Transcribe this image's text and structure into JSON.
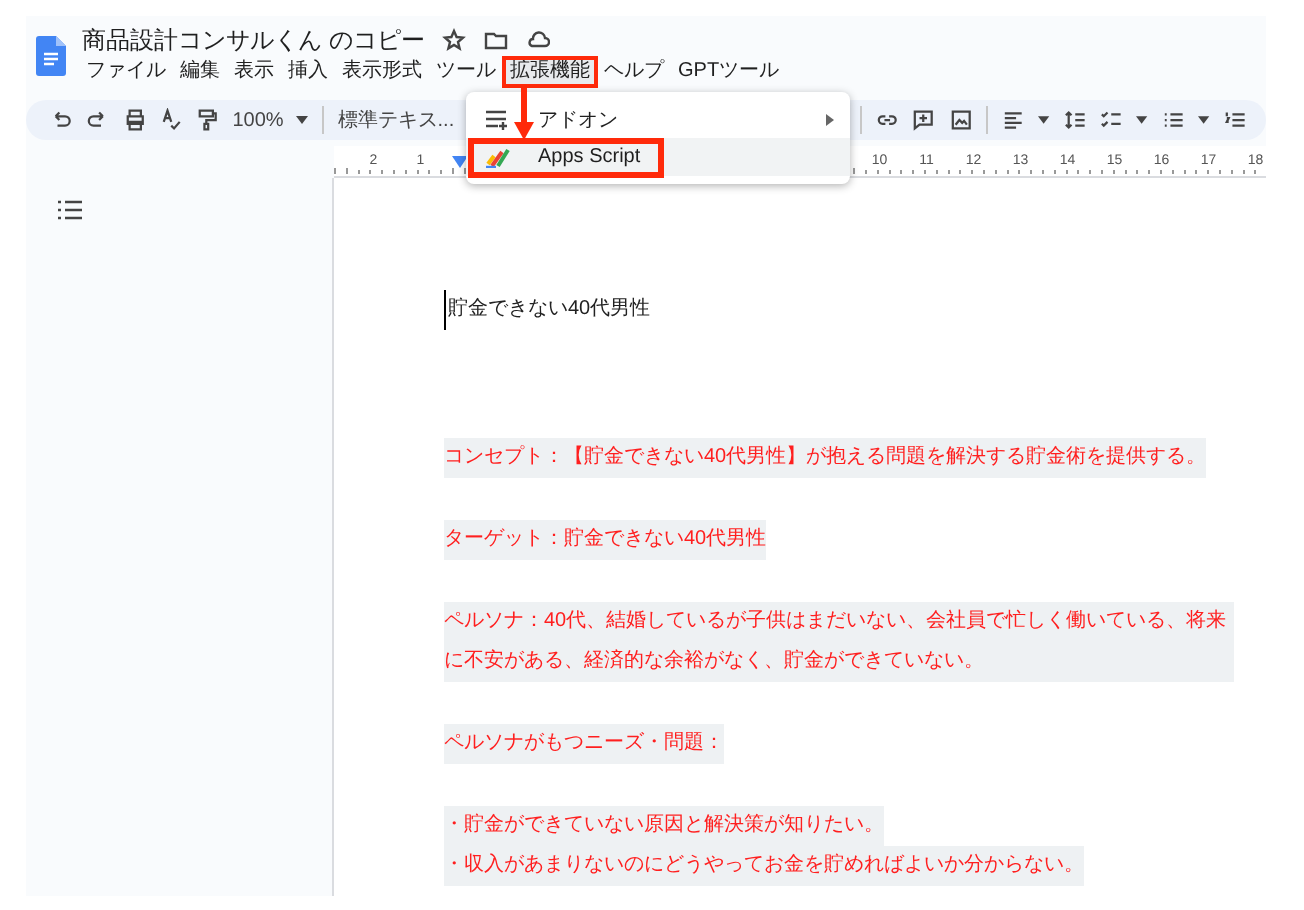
{
  "document": {
    "title": "商品設計コンサルくん のコピー"
  },
  "menubar": [
    {
      "label": "ファイル",
      "annotated": false
    },
    {
      "label": "編集",
      "annotated": false
    },
    {
      "label": "表示",
      "annotated": false
    },
    {
      "label": "挿入",
      "annotated": false
    },
    {
      "label": "表示形式",
      "annotated": false
    },
    {
      "label": "ツール",
      "annotated": false
    },
    {
      "label": "拡張機能",
      "annotated": true
    },
    {
      "label": "ヘルプ",
      "annotated": false
    },
    {
      "label": "GPTツール",
      "annotated": false
    }
  ],
  "toolbar": {
    "zoom": "100%",
    "style": "標準テキス..."
  },
  "ruler": {
    "left_labels": [
      "2",
      "1"
    ],
    "right_labels": [
      "10",
      "11",
      "12",
      "13",
      "14",
      "15",
      "16",
      "17",
      "18"
    ]
  },
  "dropdown": [
    {
      "label": "アドオン",
      "submenu": true,
      "selected": false,
      "annotated": false
    },
    {
      "label": "Apps Script",
      "submenu": false,
      "selected": true,
      "annotated": true
    }
  ],
  "paragraphs": [
    {
      "kind": "plain",
      "text": "貯金できない40代男性"
    },
    {
      "kind": "highlighted",
      "text": "コンセプト：【貯金できない40代男性】が抱える問題を解決する貯金術を提供する。"
    },
    {
      "kind": "highlighted",
      "text": "ターゲット：貯金できない40代男性"
    },
    {
      "kind": "highlighted",
      "text": "ペルソナ：40代、結婚しているが子供はまだいない、会社員で忙しく働いている、将来に不安がある、経済的な余裕がなく、貯金ができていない。"
    },
    {
      "kind": "highlighted",
      "text": "ペルソナがもつニーズ・問題："
    },
    {
      "kind": "bullet",
      "text": "・貯金ができていない原因と解決策が知りたい。"
    },
    {
      "kind": "bullet",
      "text": "・収入があまりないのにどうやってお金を貯めればよいか分からない。"
    }
  ]
}
